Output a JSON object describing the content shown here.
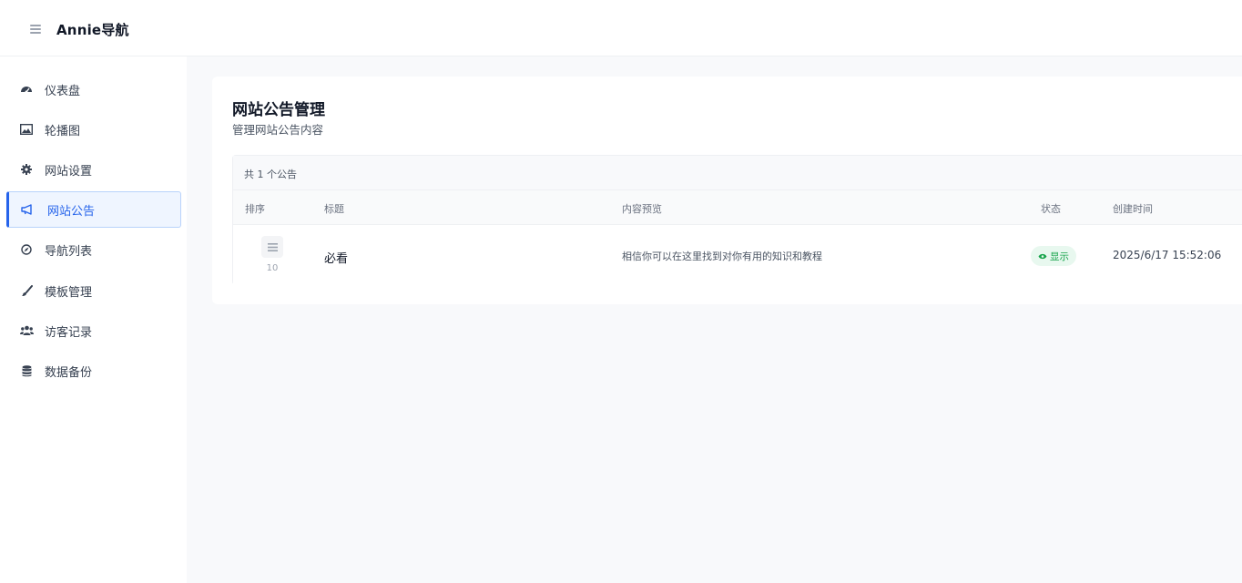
{
  "app": {
    "brand": "Annie导航"
  },
  "sidebar": {
    "items": [
      {
        "label": "仪表盘",
        "icon": "dashboard-icon"
      },
      {
        "label": "轮播图",
        "icon": "image-icon"
      },
      {
        "label": "网站设置",
        "icon": "gear-icon"
      },
      {
        "label": "网站公告",
        "icon": "megaphone-icon",
        "active": true
      },
      {
        "label": "导航列表",
        "icon": "compass-icon"
      },
      {
        "label": "模板管理",
        "icon": "brush-icon"
      },
      {
        "label": "访客记录",
        "icon": "users-icon"
      },
      {
        "label": "数据备份",
        "icon": "database-icon"
      }
    ]
  },
  "page": {
    "title": "网站公告管理",
    "subtitle": "管理网站公告内容"
  },
  "table": {
    "count_text": "共 1 个公告",
    "headers": {
      "order": "排序",
      "title": "标题",
      "preview": "内容预览",
      "status": "状态",
      "created": "创建时间"
    },
    "rows": [
      {
        "order": "10",
        "title": "必看",
        "preview": "相信你可以在这里找到对你有用的知识和教程",
        "status": "显示",
        "created": "2025/6/17 15:52:06"
      }
    ]
  },
  "colors": {
    "accent": "#2563eb",
    "status_green": "#16a34a",
    "background": "#f8f9fb"
  }
}
